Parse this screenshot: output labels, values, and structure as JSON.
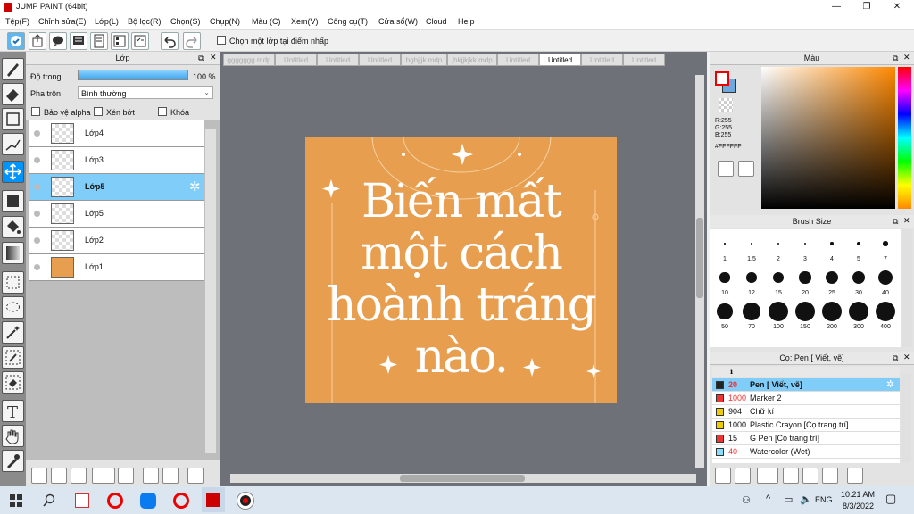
{
  "window": {
    "title": "JUMP PAINT (64bit)",
    "minimize": "—",
    "maximize": "❐",
    "close": "✕"
  },
  "menu": [
    "Tệp(F)",
    "Chỉnh sửa(E)",
    "Lớp(L)",
    "Bộ lọc(R)",
    "Chọn(S)",
    "Chụp(N)",
    "Màu (C)",
    "Xem(V)",
    "Công cụ(T)",
    "Cửa sổ(W)",
    "Cloud",
    "Help"
  ],
  "toolbar": {
    "select_layer_label": "Chọn một lớp tại điểm nhấp"
  },
  "layer_panel": {
    "title": "Lớp",
    "opacity_label": "Độ trong",
    "opacity_value": "100 %",
    "opacity_fraction": 1.0,
    "blend_label": "Pha trộn",
    "blend_value": "Bình thường",
    "protect_alpha": "Bảo vệ alpha",
    "clipping": "Xén bớt",
    "lock": "Khóa",
    "layers": [
      {
        "name": "Lớp4",
        "selected": false
      },
      {
        "name": "Lớp3",
        "selected": false
      },
      {
        "name": "Lớp5",
        "selected": true
      },
      {
        "name": "Lớp5",
        "selected": false
      },
      {
        "name": "Lớp2",
        "selected": false
      },
      {
        "name": "Lớp1",
        "selected": false
      }
    ]
  },
  "tabs": [
    {
      "label": "ggggggg.mdp",
      "active": false
    },
    {
      "label": "Untitled",
      "active": false
    },
    {
      "label": "Untitled",
      "active": false
    },
    {
      "label": "Untitled",
      "active": false
    },
    {
      "label": "hghjjjk.mdp",
      "active": false
    },
    {
      "label": "jhkjjkjkk.mdp",
      "active": false
    },
    {
      "label": "Untitled",
      "active": false
    },
    {
      "label": "Untitled",
      "active": true
    },
    {
      "label": "Untitled",
      "active": false
    },
    {
      "label": "Untitled",
      "active": false
    }
  ],
  "canvas": {
    "bg_color": "#E89E4F",
    "text_lines": [
      "Biến mất",
      "một cách",
      "hoành tráng",
      "nào."
    ]
  },
  "color_panel": {
    "title": "Màu",
    "r": "R:255",
    "g": "G:255",
    "b": "B:255",
    "hex": "#FFFFFF",
    "hue_color": "#FF8800"
  },
  "brush_size_panel": {
    "title": "Brush Size",
    "sizes": [
      "1",
      "1.5",
      "2",
      "3",
      "4",
      "5",
      "7",
      "10",
      "12",
      "15",
      "20",
      "25",
      "30",
      "40",
      "50",
      "70",
      "100",
      "150",
      "200",
      "300",
      "400"
    ]
  },
  "brush_panel": {
    "title": "Cọ: Pen [ Viết, vẽ]",
    "brushes": [
      {
        "size": "20",
        "name": "Pen [ Viết, vẽ]",
        "color": "#222222",
        "selected": true
      },
      {
        "size": "1000",
        "name": "Marker 2",
        "color": "#ee3333",
        "selected": false
      },
      {
        "size": "904",
        "name": "Chữ kí",
        "color": "#eecc00",
        "selected": false
      },
      {
        "size": "1000",
        "name": "Plastic Crayon [Cọ trang trí]",
        "color": "#eecc00",
        "selected": false
      },
      {
        "size": "15",
        "name": "G Pen [Cọ trang trí]",
        "color": "#ee3333",
        "selected": false
      },
      {
        "size": "40",
        "name": "Watercolor (Wet)",
        "color": "#88ddff",
        "selected": false
      }
    ]
  },
  "taskbar": {
    "lang": "ENG",
    "time": "10:21 AM",
    "date": "8/3/2022"
  }
}
